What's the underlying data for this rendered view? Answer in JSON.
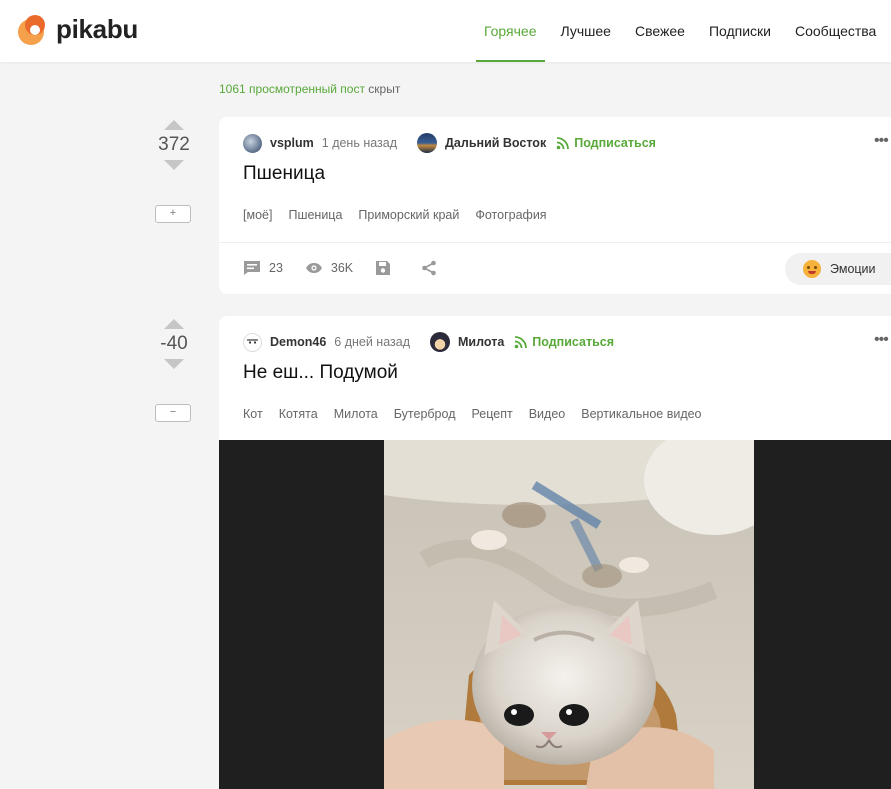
{
  "header": {
    "logo_text": "pikabu",
    "nav": [
      {
        "label": "Горячее",
        "active": true
      },
      {
        "label": "Лучшее",
        "active": false
      },
      {
        "label": "Свежее",
        "active": false
      },
      {
        "label": "Подписки",
        "active": false
      },
      {
        "label": "Сообщества",
        "active": false
      }
    ]
  },
  "hidden_notice": {
    "link_text": "1061 просмотренный пост",
    "suffix": " скрыт"
  },
  "posts": [
    {
      "rating": "372",
      "toggle_label": "+",
      "author": "vsplum",
      "time": "1 день назад",
      "community": "Дальний Восток",
      "subscribe": "Подписаться",
      "title": "Пшеница",
      "tags": [
        "[моё]",
        "Пшеница",
        "Приморский край",
        "Фотография"
      ],
      "comments": "23",
      "views": "36K",
      "emotions_label": "Эмоции"
    },
    {
      "rating": "-40",
      "toggle_label": "−",
      "author": "Demon46",
      "time": "6 дней назад",
      "community": "Милота",
      "subscribe": "Подписаться",
      "title": "Не еш... Подумой",
      "tags": [
        "Кот",
        "Котята",
        "Милота",
        "Бутерброд",
        "Рецепт",
        "Видео",
        "Вертикальное видео"
      ]
    }
  ],
  "colors": {
    "accent": "#58a93a",
    "background": "#f4f4f4",
    "card": "#ffffff",
    "video_bg": "#1f1f1f"
  },
  "icons": {
    "more": "more-dots-icon",
    "comments": "comment-icon",
    "views": "eye-icon",
    "save": "save-icon",
    "share": "share-icon",
    "subscribe": "rss-icon"
  }
}
